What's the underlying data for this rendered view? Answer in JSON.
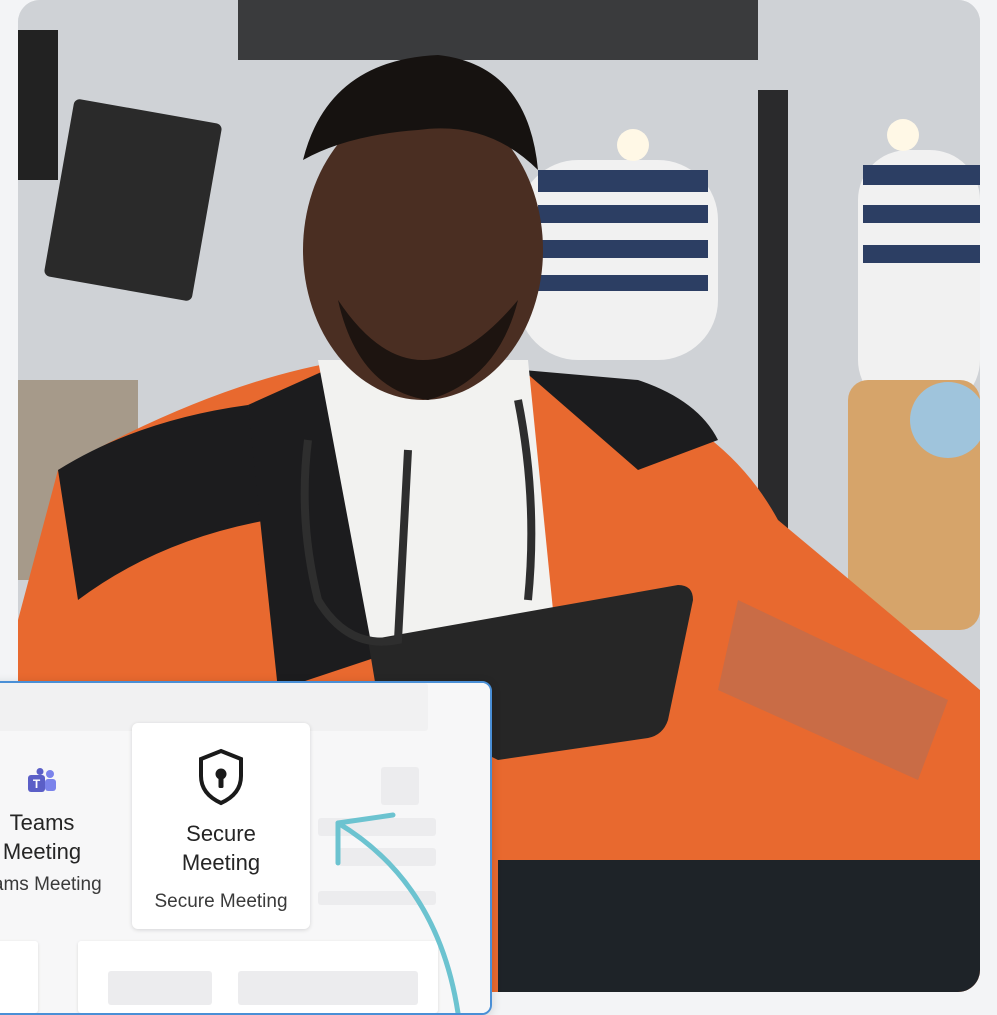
{
  "scene": {
    "image_description": "",
    "accent_color": "#4a8fd6"
  },
  "meeting_panel": {
    "options": [
      {
        "icon": "teams-icon",
        "title_line1": "Teams",
        "title_line2": "Meeting",
        "subtitle": "eams Meeting"
      },
      {
        "icon": "shield-lock-icon",
        "title_line1": "Secure",
        "title_line2": "Meeting",
        "subtitle": "Secure Meeting"
      }
    ]
  },
  "colors": {
    "panel_border": "#4a8fd6",
    "arrow": "#6cc3d0",
    "teams_icon": "#5b5fc7"
  }
}
